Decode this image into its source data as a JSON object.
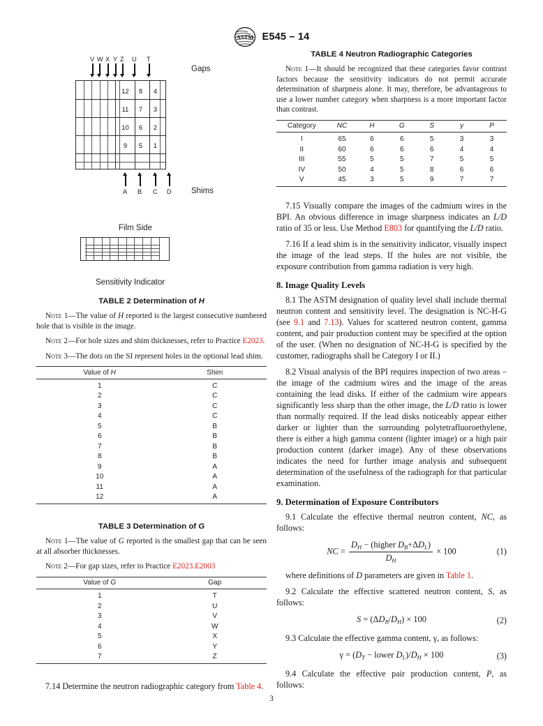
{
  "header": {
    "logo_icon": "astm-logo-icon",
    "designation": "E545 – 14"
  },
  "page_number": "3",
  "figure": {
    "gaps_label": "Gaps",
    "shims_label": "Shims",
    "film_side_label": "Film Side",
    "caption": "Sensitivity Indicator",
    "gap_headers": [
      "V",
      "W",
      "X",
      "Y",
      "Z",
      "U",
      "T"
    ],
    "shim_headers": [
      "A",
      "B",
      "C",
      "D"
    ],
    "hole_numbers": [
      [
        "12",
        "8",
        "4"
      ],
      [
        "11",
        "7",
        "3"
      ],
      [
        "10",
        "6",
        "2"
      ],
      [
        "9",
        "5",
        "1"
      ]
    ]
  },
  "table2": {
    "title": "TABLE 2 Determination of H",
    "title_plain": "TABLE 2 Determination of ",
    "title_italic": "H",
    "notes": [
      {
        "label": "Note 1",
        "text": "—The value of H reported is the largest consecutive numbered hole that is visible in the image."
      },
      {
        "label": "Note 2",
        "text": "—For hole sizes and shim thicknesses, refer to Practice E2023."
      },
      {
        "label": "Note 3",
        "text": "—The dots on the SI represent holes in the optional lead shim."
      }
    ],
    "note2_ref": "E2023",
    "columns": [
      "Value of H",
      "Shim"
    ],
    "rows": [
      [
        "1",
        "C"
      ],
      [
        "2",
        "C"
      ],
      [
        "3",
        "C"
      ],
      [
        "4",
        "C"
      ],
      [
        "5",
        "B"
      ],
      [
        "6",
        "B"
      ],
      [
        "7",
        "B"
      ],
      [
        "8",
        "B"
      ],
      [
        "9",
        "A"
      ],
      [
        "10",
        "A"
      ],
      [
        "11",
        "A"
      ],
      [
        "12",
        "A"
      ]
    ]
  },
  "table3": {
    "title_plain": "TABLE 3 Determination of ",
    "title_italic": "G",
    "notes": [
      {
        "label": "Note 1",
        "text": "—The value of G reported is the smallest gap that can be seen at all absorber thicknesses."
      },
      {
        "label": "Note 2",
        "text": "—For gap sizes, refer to Practice E2023.E2003"
      }
    ],
    "note2_ref": "E2023.E2003",
    "columns": [
      "Value of G",
      "Gap"
    ],
    "rows": [
      [
        "1",
        "T"
      ],
      [
        "2",
        "U"
      ],
      [
        "3",
        "V"
      ],
      [
        "4",
        "W"
      ],
      [
        "5",
        "X"
      ],
      [
        "6",
        "Y"
      ],
      [
        "7",
        "Z"
      ]
    ]
  },
  "table4": {
    "title": "TABLE 4 Neutron Radiographic Categories",
    "note_label": "Note 1",
    "note_text": "—It should be recognized that these categories favor contrast factors because the sensitivity indicators do not permit accurate determination of sharpness alone. It may, therefore, be advantageous to use a lower number category when sharpness is a more important factor than contrast.",
    "columns": [
      "Category",
      "NC",
      "H",
      "G",
      "S",
      "γ",
      "P"
    ],
    "rows": [
      [
        "I",
        "65",
        "6",
        "6",
        "5",
        "3",
        "3"
      ],
      [
        "II",
        "60",
        "6",
        "6",
        "6",
        "4",
        "4"
      ],
      [
        "III",
        "55",
        "5",
        "5",
        "7",
        "5",
        "5"
      ],
      [
        "IV",
        "50",
        "4",
        "5",
        "8",
        "6",
        "6"
      ],
      [
        "V",
        "45",
        "3",
        "5",
        "9",
        "7",
        "7"
      ]
    ]
  },
  "left_column": {
    "para_7_14_a": "7.14 Determine the neutron radiographic category from ",
    "para_7_14_ref": "Table 4",
    "para_7_14_b": "."
  },
  "right_column": {
    "para_7_15_a": "7.15 Visually compare the images of the cadmium wires in the BPI. An obvious difference in image sharpness indicates an ",
    "para_7_15_ld1": "L/D",
    "para_7_15_b": " ratio of 35 or less. Use Method ",
    "para_7_15_ref": "E803",
    "para_7_15_c": " for quantifying the ",
    "para_7_15_ld2": "L/D",
    "para_7_15_d": " ratio.",
    "para_7_16": "7.16 If a lead shim is in the sensitivity indicator, visually inspect the image of the lead steps. If the holes are not visible, the exposure contribution from gamma radiation is very high.",
    "heading_8": "8. Image Quality Levels",
    "para_8_1_a": "8.1 The ASTM designation of quality level shall include thermal neutron content and sensitivity level. The designation is NC-H-G (see ",
    "para_8_1_ref1": "9.1",
    "para_8_1_b": " and ",
    "para_8_1_ref2": "7.13",
    "para_8_1_c": "). Values for scattered neutron content, gamma content, and pair production content may be specified at the option of the user. (When no designation of NC-H-G is specified by the customer, radiographs shall be Category I or II.)",
    "para_8_2_a": "8.2 Visual analysis of the BPI requires inspection of two areas – the image of the cadmium wires and the image of the areas containing the lead disks. If either of the cadmium wire appears significantly less sharp than the other image, the ",
    "para_8_2_ld": "L/D",
    "para_8_2_b": " ratio is lower than normally required. If the lead disks noticeably appear either darker or lighter than the surrounding polytetrafluoroethylene, there is either a high gamma content (lighter image) or a high pair production content (darker image). Any of these observations indicates the need for further image analysis and subsequent determination of the usefulness of the radiograph for that particular examination.",
    "heading_9": "9. Determination of Exposure Contributors",
    "para_9_1_a": "9.1 Calculate the effective thermal neutron content, ",
    "para_9_1_nc": "NC",
    "para_9_1_b": ", as follows:",
    "eq1": {
      "lhs": "NC",
      "eq": "=",
      "num_pre": "D",
      "num_sub1": "H",
      "num_mid": " − (higher D",
      "num_sub2": "B",
      "num_mid2": "+ΔD",
      "num_sub3": "L",
      "num_end": ")",
      "den_pre": "D",
      "den_sub": "H",
      "tail": "× 100",
      "number": "(1)"
    },
    "para_where_a": "where definitions of ",
    "para_where_d": "D",
    "para_where_b": " parameters are given in ",
    "para_where_ref": "Table 1",
    "para_where_c": ".",
    "para_9_2_a": "9.2 Calculate the effective scattered neutron content, ",
    "para_9_2_s": "S",
    "para_9_2_b": ", as follows:",
    "eq2": {
      "text": "S = (ΔD",
      "sub1": "B",
      "mid": "/D",
      "sub2": "H",
      "end": ") × 100",
      "number": "(2)"
    },
    "para_9_3_a": "9.3 Calculate the effective gamma content, γ, as follows:",
    "eq3": {
      "text": "γ = (D",
      "sub1": "T",
      "mid": " − lower D",
      "sub2": "L",
      "mid2": ")/D",
      "sub3": "H",
      "end": " × 100",
      "number": "(3)"
    },
    "para_9_4_a": "9.4 Calculate the effective pair production content, ",
    "para_9_4_p": "P",
    "para_9_4_b": ", as follows:"
  },
  "colors": {
    "link_red": "#e0201b",
    "text": "#1a1a1a",
    "rule": "#333333"
  }
}
